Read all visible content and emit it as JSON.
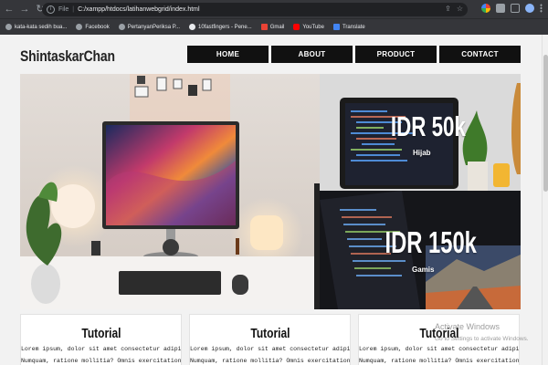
{
  "browser": {
    "url_scheme": "File",
    "url": "C:/xampp/htdocs/latihanwebgrid/index.html",
    "nav": {
      "back": "←",
      "forward": "→",
      "reload": "↻"
    },
    "omnibox_icons": {
      "share": "⇪",
      "star": "☆"
    },
    "bookmarks": [
      {
        "label": "kata-kata sedih bua...",
        "color": "#9aa0a6"
      },
      {
        "label": "Facebook",
        "color": "#9aa0a6"
      },
      {
        "label": "PertanyanPeriksa P...",
        "color": "#9aa0a6"
      },
      {
        "label": "10fastfingers - Pene...",
        "color": "#9aa0a6"
      },
      {
        "label": "Gmail",
        "color": "#ea4335"
      },
      {
        "label": "YouTube",
        "color": "#ff0000"
      },
      {
        "label": "Translate",
        "color": "#4285f4"
      }
    ]
  },
  "site": {
    "brand": "ShintaskarChan",
    "menu": [
      "HOME",
      "ABOUT",
      "PRODUCT",
      "CONTACT"
    ],
    "promos": [
      {
        "price": "IDR 50k",
        "label": "Hijab"
      },
      {
        "price": "IDR 150k",
        "label": "Gamis"
      }
    ],
    "cards": [
      {
        "title": "Tutorial",
        "line1": "Lorem ipsum, dolor sit amet consectetur adipisicing elit.",
        "line2": "Numquam, ratione mollitia? Omnis exercitationem at"
      },
      {
        "title": "Tutorial",
        "line1": "Lorem ipsum, dolor sit amet consectetur adipisicing elit.",
        "line2": "Numquam, ratione mollitia? Omnis exercitationem at"
      },
      {
        "title": "Tutorial",
        "line1": "Lorem ipsum, dolor sit amet consectetur adipisicing elit.",
        "line2": "Numquam, ratione mollitia? Omnis exercitationem at"
      }
    ]
  },
  "watermark": {
    "title": "Activate Windows",
    "subtitle": "Go to Settings to activate Windows."
  },
  "colors": {
    "nav_bg": "#111111",
    "page_bg": "#f2f2f2",
    "chrome_bg": "#35363a"
  }
}
